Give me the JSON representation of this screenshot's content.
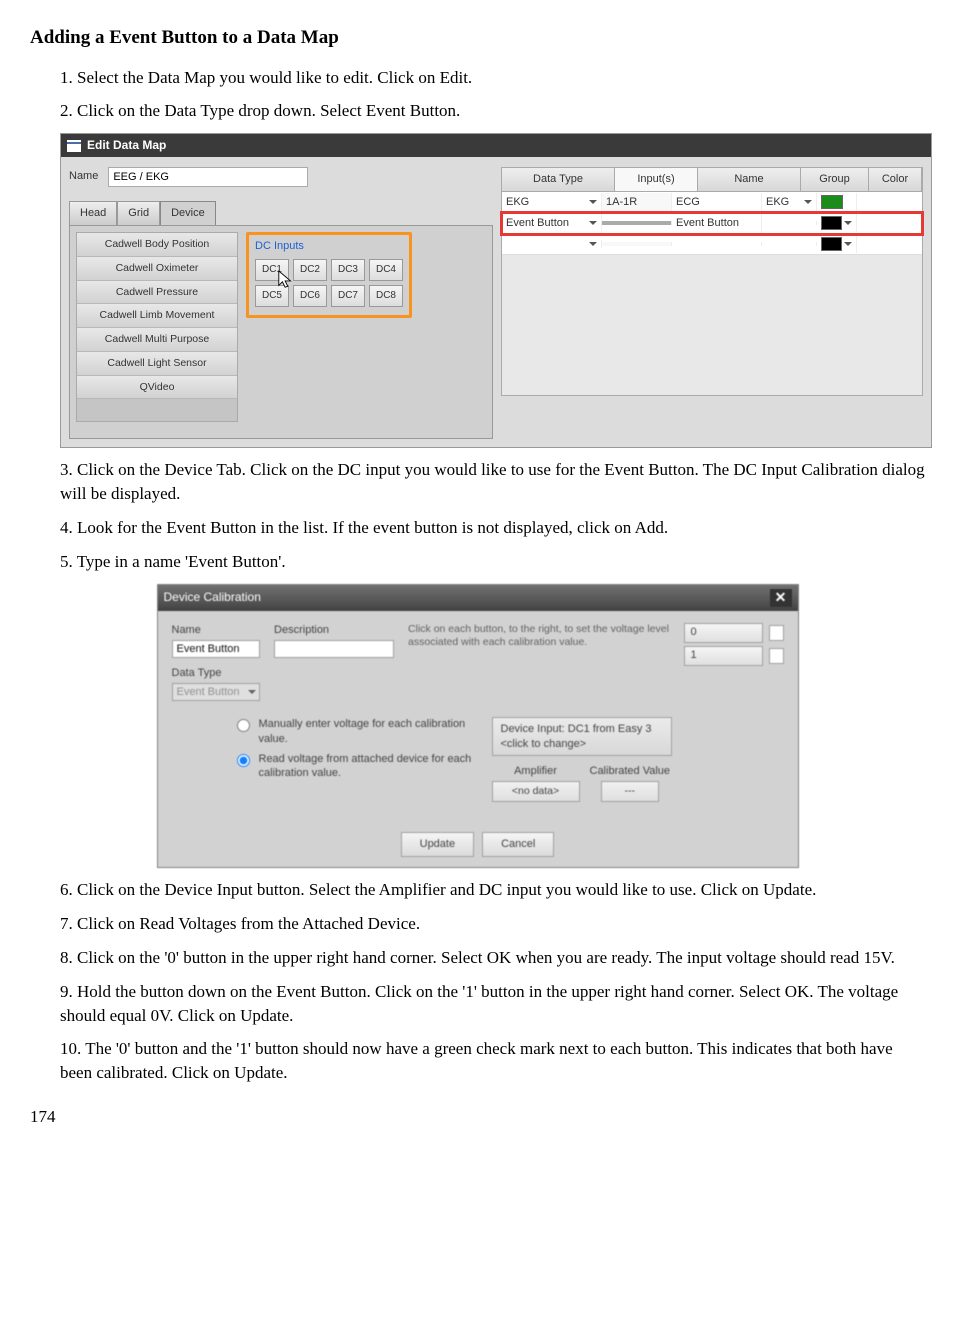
{
  "title": "Adding a Event Button to a Data Map",
  "steps": {
    "s1": "1.  Select the Data Map you would like to edit.  Click on Edit.",
    "s2": "2.  Click on the Data Type drop down. Select Event Button.",
    "s3": "3.  Click on the Device Tab.  Click on the DC input you would like to use for the Event Button.  The DC Input Calibration dialog will be displayed.",
    "s4": "4.  Look for the Event Button in the list.  If the event button is not displayed, click on Add.",
    "s5": "5.  Type in a name 'Event Button'.",
    "s6": "6.  Click on the Device Input button.  Select the Amplifier and DC input you would like to use.  Click on Update.",
    "s7": "7.  Click on Read Voltages from the Attached Device.",
    "s8": "8.  Click on the '0' button in the upper right hand corner.  Select OK when you are ready.  The input voltage should read 15V.",
    "s9": "9.  Hold the button down on the Event Button.  Click on the '1' button in the upper right hand corner.  Select OK.  The voltage should equal 0V.  Click on Update.",
    "s10": "10.  The '0' button and the '1' button should now have a green check mark next to each button.  This indicates that both have been calibrated.  Click on Update."
  },
  "page": "174",
  "shot1": {
    "title": "Edit Data Map",
    "name_label": "Name",
    "name_value": "EEG / EKG",
    "tabs": [
      "Head",
      "Grid",
      "Device"
    ],
    "devices": [
      "Cadwell Body Position",
      "Cadwell Oximeter",
      "Cadwell Pressure",
      "Cadwell Limb Movement",
      "Cadwell Multi Purpose",
      "Cadwell Light Sensor",
      "QVideo"
    ],
    "dc_header": "DC Inputs",
    "dc_buttons": [
      "DC1",
      "DC2",
      "DC3",
      "DC4",
      "DC5",
      "DC6",
      "DC7",
      "DC8"
    ],
    "headers": {
      "type": "Data Type",
      "input": "Input(s)",
      "name": "Name",
      "group": "Group",
      "color": "Color"
    },
    "row1": {
      "type": "EKG",
      "input": "1A-1R",
      "name": "ECG",
      "group": "EKG",
      "color": "#1a8c1a"
    },
    "row2": {
      "type": "Event Button",
      "input": "",
      "name": "Event Button",
      "group": "",
      "color": "#000000"
    },
    "row3": {
      "color": "#000000"
    }
  },
  "shot2": {
    "title": "Device Calibration",
    "name_label": "Name",
    "name_value": "Event Button",
    "desc_label": "Description",
    "type_label": "Data Type",
    "type_value": "Event Button",
    "help": "Click on each button, to the right, to set the voltage level associated with each calibration value.",
    "val0": "0",
    "val1": "1",
    "radio1": "Manually enter voltage for each calibration value.",
    "radio2": "Read voltage from attached device for each calibration value.",
    "devinput_line1": "Device Input: DC1 from Easy 3",
    "devinput_line2": "<click to change>",
    "amp_label": "Amplifier",
    "cal_label": "Calibrated Value",
    "amp_val": "<no data>",
    "cal_val": "---",
    "update": "Update",
    "cancel": "Cancel"
  }
}
